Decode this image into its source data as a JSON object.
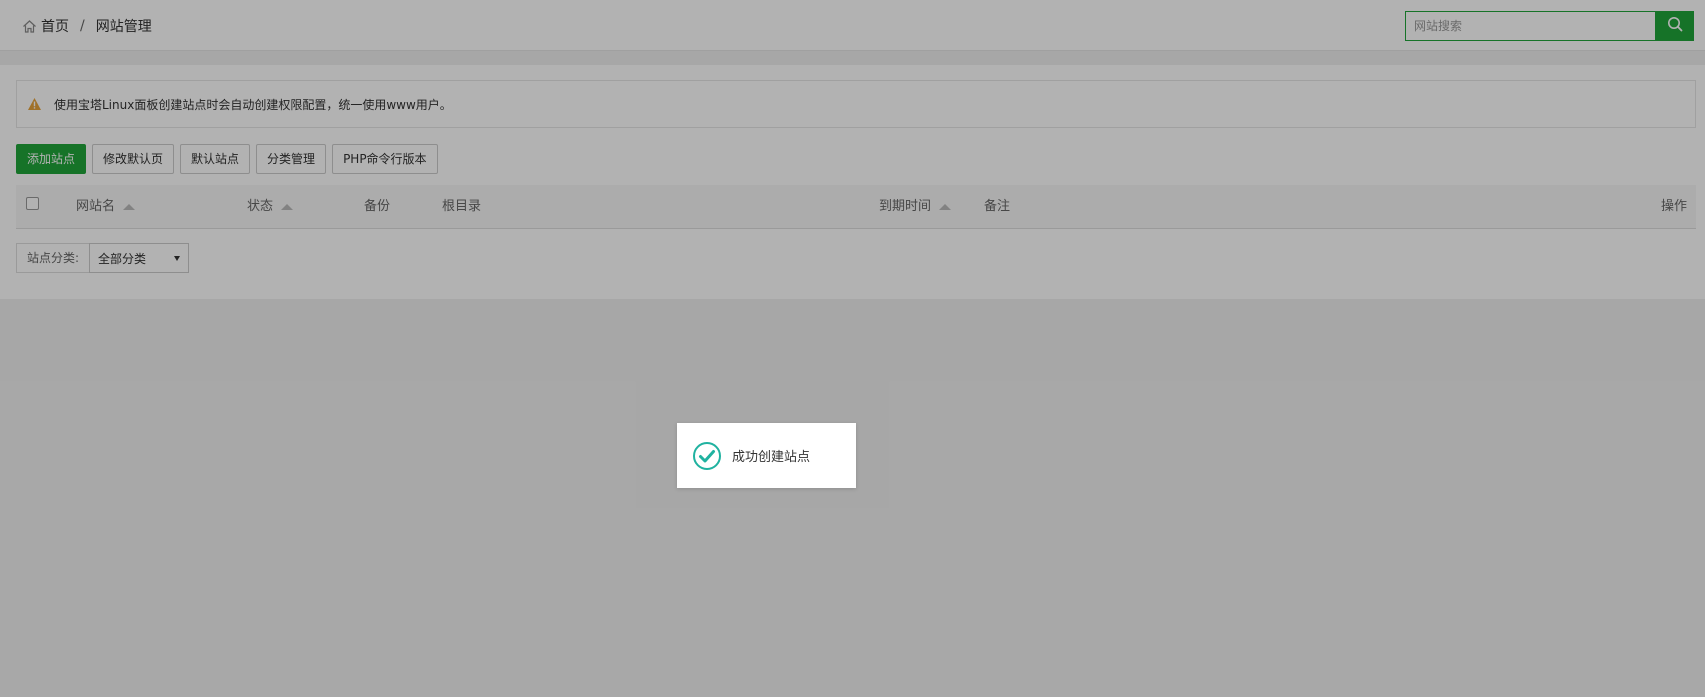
{
  "breadcrumb": {
    "home": "首页",
    "separator": "/",
    "current": "网站管理"
  },
  "search": {
    "placeholder": "网站搜索",
    "value": ""
  },
  "alert": {
    "text": "使用宝塔Linux面板创建站点时会自动创建权限配置，统一使用www用户。"
  },
  "toolbar": {
    "add_site": "添加站点",
    "edit_default_page": "修改默认页",
    "default_site": "默认站点",
    "category_manage": "分类管理",
    "php_cli_version": "PHP命令行版本"
  },
  "table": {
    "columns": {
      "name": "网站名",
      "status": "状态",
      "backup": "备份",
      "root": "根目录",
      "expire": "到期时间",
      "remark": "备注",
      "action": "操作"
    }
  },
  "filter": {
    "label": "站点分类:",
    "selected": "全部分类"
  },
  "toast": {
    "message": "成功创建站点"
  },
  "colors": {
    "brand_green": "#20a53a",
    "toast_check": "#20b2a0",
    "warning": "#e6a23c"
  }
}
